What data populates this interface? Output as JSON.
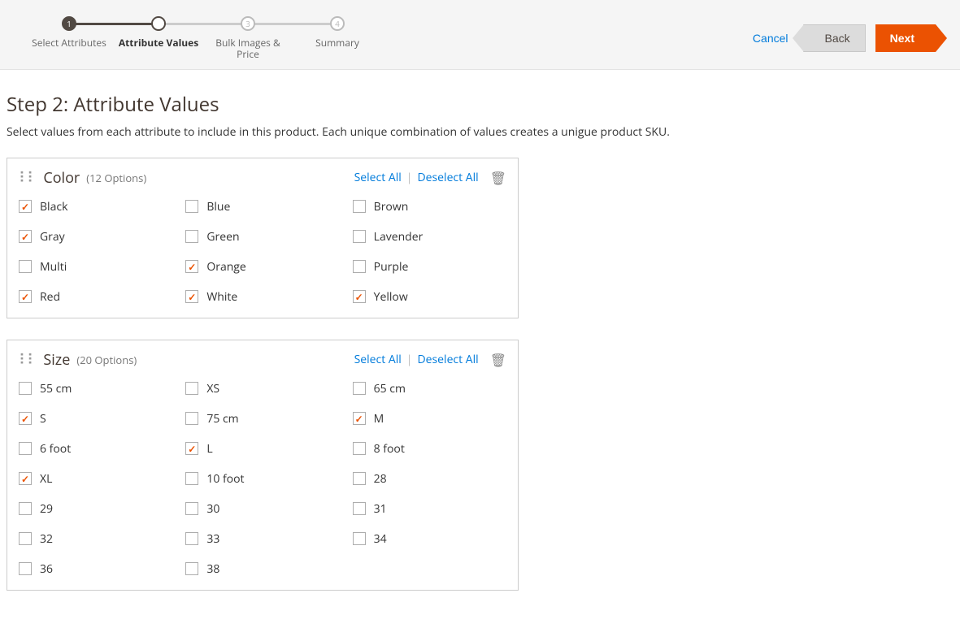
{
  "wizard": {
    "steps": [
      {
        "label": "Select Attributes",
        "state": "done",
        "num": "1"
      },
      {
        "label": "Attribute Values",
        "state": "active",
        "num": ""
      },
      {
        "label": "Bulk Images & Price",
        "state": "future",
        "num": "3"
      },
      {
        "label": "Summary",
        "state": "future",
        "num": "4"
      }
    ]
  },
  "actions": {
    "cancel": "Cancel",
    "back": "Back",
    "next": "Next"
  },
  "page": {
    "title": "Step 2: Attribute Values",
    "description": "Select values from each attribute to include in this product. Each unique combination of values creates a unigue product SKU."
  },
  "panelActions": {
    "selectAll": "Select All",
    "deselectAll": "Deselect All"
  },
  "attributes": [
    {
      "name": "Color",
      "countText": "(12 Options)",
      "options": [
        {
          "label": "Black",
          "checked": true
        },
        {
          "label": "Blue",
          "checked": false
        },
        {
          "label": "Brown",
          "checked": false
        },
        {
          "label": "Gray",
          "checked": true
        },
        {
          "label": "Green",
          "checked": false
        },
        {
          "label": "Lavender",
          "checked": false
        },
        {
          "label": "Multi",
          "checked": false
        },
        {
          "label": "Orange",
          "checked": true
        },
        {
          "label": "Purple",
          "checked": false
        },
        {
          "label": "Red",
          "checked": true
        },
        {
          "label": "White",
          "checked": true
        },
        {
          "label": "Yellow",
          "checked": true
        }
      ]
    },
    {
      "name": "Size",
      "countText": "(20 Options)",
      "options": [
        {
          "label": "55 cm",
          "checked": false
        },
        {
          "label": "XS",
          "checked": false
        },
        {
          "label": "65 cm",
          "checked": false
        },
        {
          "label": "S",
          "checked": true
        },
        {
          "label": "75 cm",
          "checked": false
        },
        {
          "label": "M",
          "checked": true
        },
        {
          "label": "6 foot",
          "checked": false
        },
        {
          "label": "L",
          "checked": true
        },
        {
          "label": "8 foot",
          "checked": false
        },
        {
          "label": "XL",
          "checked": true
        },
        {
          "label": "10 foot",
          "checked": false
        },
        {
          "label": "28",
          "checked": false
        },
        {
          "label": "29",
          "checked": false
        },
        {
          "label": "30",
          "checked": false
        },
        {
          "label": "31",
          "checked": false
        },
        {
          "label": "32",
          "checked": false
        },
        {
          "label": "33",
          "checked": false
        },
        {
          "label": "34",
          "checked": false
        },
        {
          "label": "36",
          "checked": false
        },
        {
          "label": "38",
          "checked": false
        }
      ]
    }
  ]
}
